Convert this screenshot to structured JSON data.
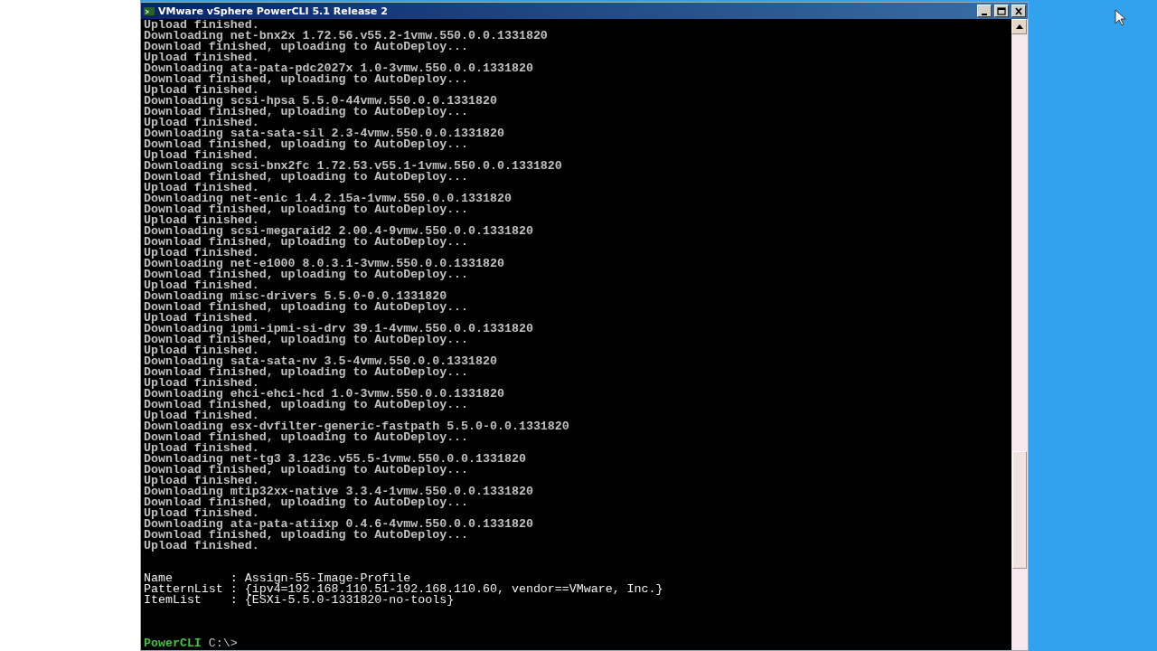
{
  "window": {
    "title": "VMware vSphere PowerCLI 5.1 Release 2"
  },
  "console": {
    "log_lines": [
      "Upload finished.",
      "Downloading net-bnx2x 1.72.56.v55.2-1vmw.550.0.0.1331820",
      "Download finished, uploading to AutoDeploy...",
      "Upload finished.",
      "Downloading ata-pata-pdc2027x 1.0-3vmw.550.0.0.1331820",
      "Download finished, uploading to AutoDeploy...",
      "Upload finished.",
      "Downloading scsi-hpsa 5.5.0-44vmw.550.0.0.1331820",
      "Download finished, uploading to AutoDeploy...",
      "Upload finished.",
      "Downloading sata-sata-sil 2.3-4vmw.550.0.0.1331820",
      "Download finished, uploading to AutoDeploy...",
      "Upload finished.",
      "Downloading scsi-bnx2fc 1.72.53.v55.1-1vmw.550.0.0.1331820",
      "Download finished, uploading to AutoDeploy...",
      "Upload finished.",
      "Downloading net-enic 1.4.2.15a-1vmw.550.0.0.1331820",
      "Download finished, uploading to AutoDeploy...",
      "Upload finished.",
      "Downloading scsi-megaraid2 2.00.4-9vmw.550.0.0.1331820",
      "Download finished, uploading to AutoDeploy...",
      "Upload finished.",
      "Downloading net-e1000 8.0.3.1-3vmw.550.0.0.1331820",
      "Download finished, uploading to AutoDeploy...",
      "Upload finished.",
      "Downloading misc-drivers 5.5.0-0.0.1331820",
      "Download finished, uploading to AutoDeploy...",
      "Upload finished.",
      "Downloading ipmi-ipmi-si-drv 39.1-4vmw.550.0.0.1331820",
      "Download finished, uploading to AutoDeploy...",
      "Upload finished.",
      "Downloading sata-sata-nv 3.5-4vmw.550.0.0.1331820",
      "Download finished, uploading to AutoDeploy...",
      "Upload finished.",
      "Downloading ehci-ehci-hcd 1.0-3vmw.550.0.0.1331820",
      "Download finished, uploading to AutoDeploy...",
      "Upload finished.",
      "Downloading esx-dvfilter-generic-fastpath 5.5.0-0.0.1331820",
      "Download finished, uploading to AutoDeploy...",
      "Upload finished.",
      "Downloading net-tg3 3.123c.v55.5-1vmw.550.0.0.1331820",
      "Download finished, uploading to AutoDeploy...",
      "Upload finished.",
      "Downloading mtip32xx-native 3.3.4-1vmw.550.0.0.1331820",
      "Download finished, uploading to AutoDeploy...",
      "Upload finished.",
      "Downloading ata-pata-atiixp 0.4.6-4vmw.550.0.0.1331820",
      "Download finished, uploading to AutoDeploy...",
      "Upload finished."
    ],
    "result_lines": [
      "Name        : Assign-55-Image-Profile",
      "PatternList : {ipv4=192.168.110.51-192.168.110.60, vendor==VMware, Inc.}",
      "ItemList    : {ESXi-5.5.0-1331820-no-tools}"
    ],
    "prompt": {
      "label": "PowerCLI",
      "path": "C:\\>"
    }
  }
}
